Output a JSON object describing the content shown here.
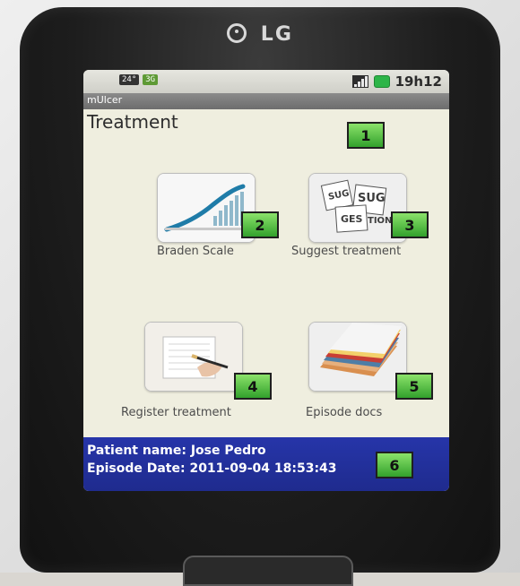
{
  "device": {
    "brand": "LG"
  },
  "status_bar": {
    "left_chip_1": "24°",
    "left_chip_2": "3G",
    "time": "19h12"
  },
  "app": {
    "name": "mUlcer",
    "title": "Treatment"
  },
  "menu": {
    "items": [
      {
        "label": "Braden Scale",
        "marker": "2",
        "icon": "braden-scale-icon"
      },
      {
        "label": "Suggest treatment",
        "marker": "3",
        "icon": "suggest-treatment-icon"
      },
      {
        "label": "Register treatment",
        "marker": "4",
        "icon": "register-treatment-icon"
      },
      {
        "label": "Episode docs",
        "marker": "5",
        "icon": "episode-docs-icon"
      }
    ]
  },
  "markers": {
    "title": "1",
    "patient": "6"
  },
  "patient": {
    "name_line": "Patient name: Jose Pedro",
    "date_line": "Episode Date: 2011-09-04 18:53:43"
  },
  "colors": {
    "marker_green": "#32a12c",
    "patient_bar": "#2635a9",
    "screen_bg": "#efeedf"
  }
}
